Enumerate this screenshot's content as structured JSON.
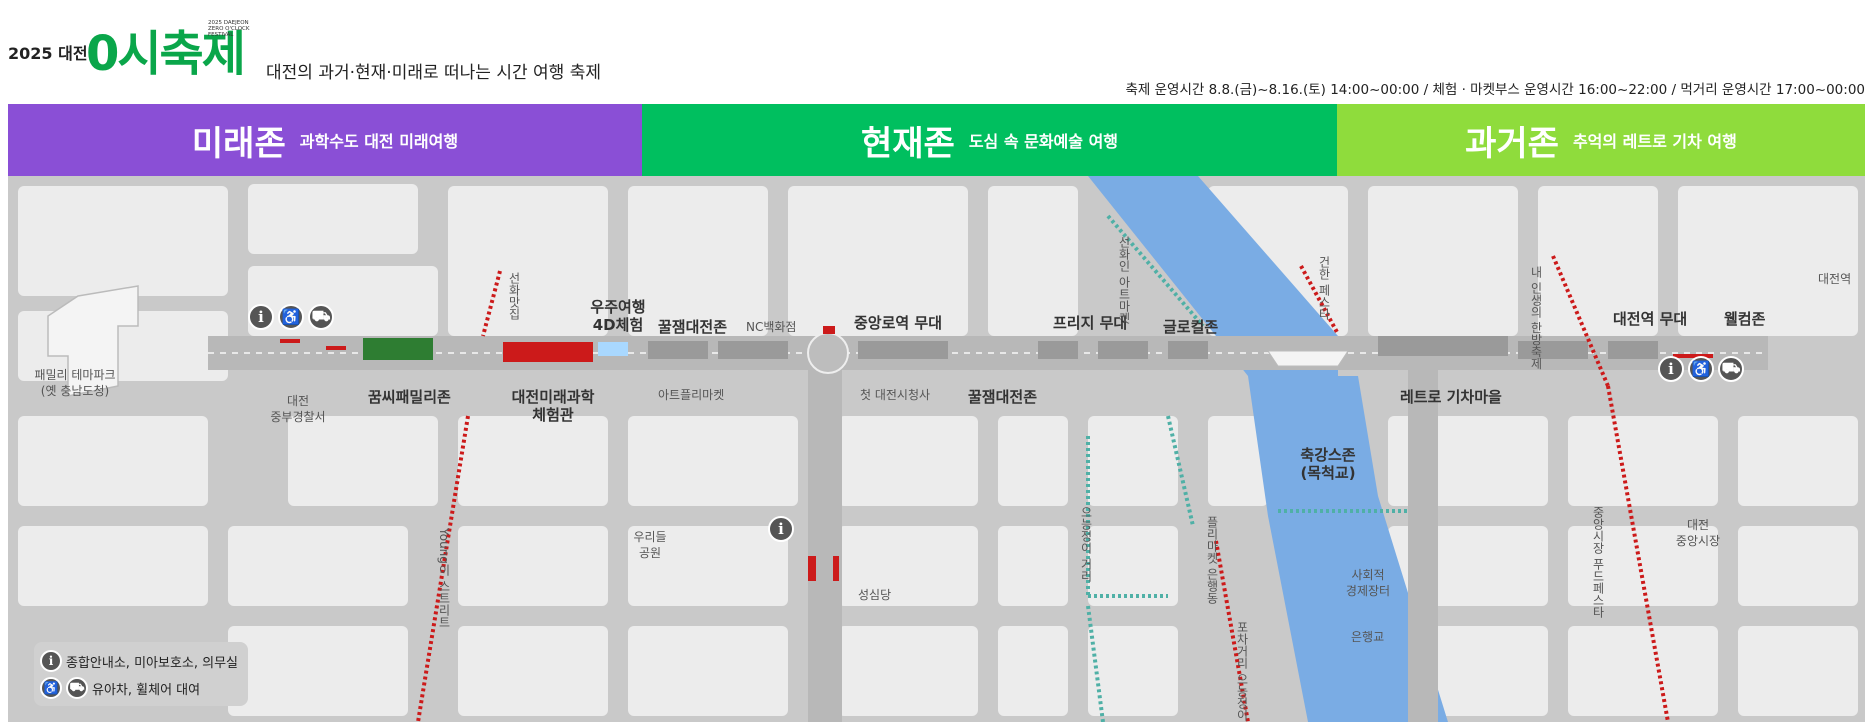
{
  "header": {
    "logo_year": "2025 대전",
    "logo_word": "0시축제",
    "logo_small": "2025 DAEJEON ZERO O'CLOCK FESTIVAL",
    "tagline": "대전의 과거·현재·미래로 떠나는 시간 여행 축제",
    "hours": "축제 운영시간 8.8.(금)~8.16.(토) 14:00~00:00 / 체험 · 마켓부스 운영시간 16:00~22:00 / 먹거리 운영시간 17:00~00:00"
  },
  "zones": [
    {
      "title": "미래존",
      "subtitle": "과학수도 대전 미래여행",
      "color": "#8a4fd6"
    },
    {
      "title": "현재존",
      "subtitle": "도심 속 문화예술 여행",
      "color": "#00bf5f"
    },
    {
      "title": "과거존",
      "subtitle": "추억의 레트로 기차 여행",
      "color": "#8fdc3c"
    }
  ],
  "colors": {
    "river": "#7aace4",
    "road": "#c4c4c4",
    "block": "#ececec",
    "booth": "#cc1a1a",
    "icon": "#555555"
  },
  "map": {
    "labels": {
      "family_park": "패밀리 테마파크",
      "old_office": "(옛 충남도청)",
      "police_1": "대전",
      "police_2": "중부경찰서",
      "kkumssi": "꿈씨패밀리존",
      "science_1": "대전미래과학",
      "science_2": "체험관",
      "space_1": "우주여행",
      "space_2": "4D체험",
      "kkul_1": "꿀잼대전존",
      "artflea": "아트플리마켓",
      "nc": "NC백화점",
      "jungang_stage": "중앙로역 무대",
      "old_cityhall": "첫 대전시청사",
      "kkul_2": "꿀잼대전존",
      "bridge_stage": "프리지 무대",
      "glocal": "글로컬존",
      "park_1": "우리들",
      "park_2": "공원",
      "seongsimdang": "성심당",
      "river_zone_1": "축강스존",
      "river_zone_2": "(목척교)",
      "social_1": "사회적",
      "social_2": "경제장터",
      "eunhaeng": "은행교",
      "retro": "레트로 기차마을",
      "station_stage": "대전역 무대",
      "welcome": "웰컴존",
      "station": "대전역",
      "market_1": "대전",
      "market_2": "중앙시장"
    },
    "streets": {
      "seonhwa": "선화맛집",
      "young": "Young이 스트리트",
      "art_market": "선화인 아트마켓",
      "gunhan": "건한 페스타",
      "eunhaeng_st": "으능정이 거리",
      "flea": "플리마켓 은행동",
      "pocha": "포차거리 으능정이",
      "nae": "내 인생의 한방축제",
      "food": "중앙시장 푸드페스타"
    },
    "icons": {
      "info": "i",
      "wheelchair": "♿",
      "stroller": "⛟"
    }
  },
  "legend": {
    "info": "종합안내소, 미아보호소, 의무실",
    "rental": "유아차, 휠체어 대여"
  }
}
